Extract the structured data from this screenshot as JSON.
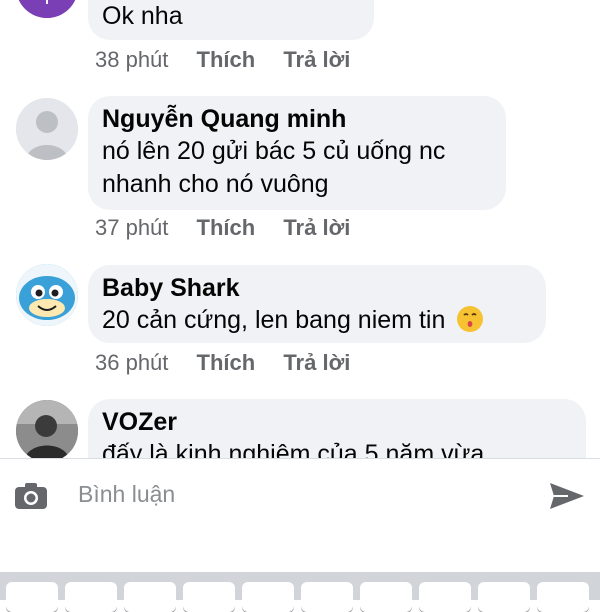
{
  "comments": [
    {
      "author": "",
      "lines": [
        "Ok nha"
      ],
      "time": "38 phút",
      "like": "Thích",
      "reply": "Trả lời",
      "avatar": "purple-avatar"
    },
    {
      "author": "Nguyễn Quang minh",
      "lines": [
        "nó lên 20 gửi bác 5 củ uống nc",
        "nhanh cho nó vuông"
      ],
      "time": "37 phút",
      "like": "Thích",
      "reply": "Trả lời",
      "avatar": "default-profile-avatar"
    },
    {
      "author": "Baby Shark",
      "lines": [
        "20 cản cứng, len bang niem tin"
      ],
      "emoji": "kissing-face-emoji",
      "time": "36 phút",
      "like": "Thích",
      "reply": "Trả lời",
      "avatar": "baby-shark-avatar"
    },
    {
      "author": "VOZer",
      "lines": [
        "đấy là kinh nghiệm của 5 năm vừa"
      ],
      "avatar": "photo-avatar"
    }
  ],
  "composer": {
    "placeholder": "Bình luận",
    "camera_icon": "camera-icon",
    "send_icon": "send-icon"
  },
  "colors": {
    "bubble": "#f0f2f5",
    "meta_text": "#65676b",
    "placeholder": "#8a8d91",
    "keyboard": "#d1d4d9"
  }
}
